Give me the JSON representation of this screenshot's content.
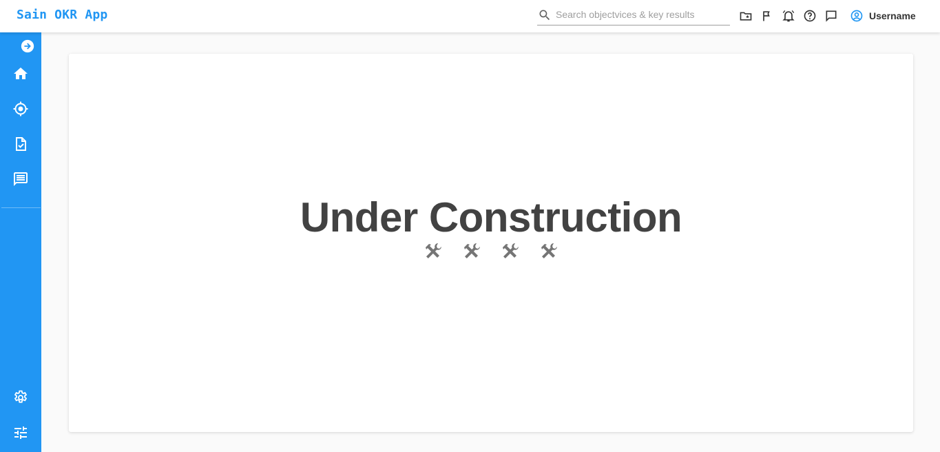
{
  "app": {
    "title": "Sain OKR App"
  },
  "search": {
    "placeholder": "Search objectvices & key results",
    "icon": "search-icon"
  },
  "toolbar": {
    "icons": [
      "folder-star-icon",
      "flag-icon",
      "bell-icon",
      "help-icon",
      "chat-icon"
    ],
    "user": {
      "name": "Username",
      "icon": "account-circle-icon"
    }
  },
  "sidebar": {
    "color": "#2196f3",
    "items": [
      {
        "icon": "expand-arrow-icon"
      },
      {
        "icon": "home-icon"
      },
      {
        "icon": "target-icon"
      },
      {
        "icon": "task-document-icon"
      },
      {
        "icon": "message-icon"
      }
    ],
    "bottom_items": [
      {
        "icon": "settings-icon"
      },
      {
        "icon": "tune-icon"
      }
    ]
  },
  "main": {
    "title": "Under Construction",
    "tools_icon": "hammer-wrench-icon",
    "tools_count": 4
  }
}
